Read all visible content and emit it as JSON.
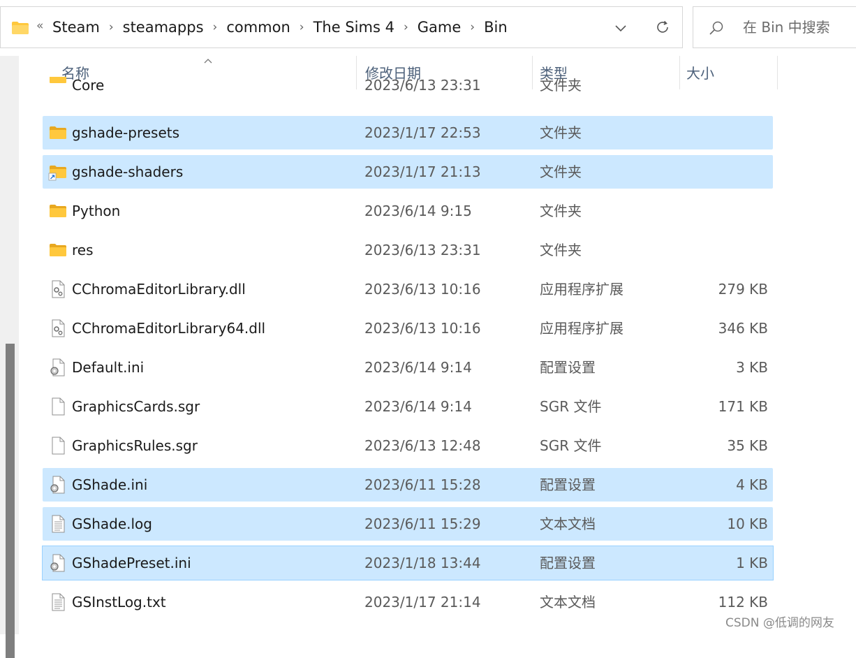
{
  "address_bar": {
    "overflow": "«",
    "crumbs": [
      "Steam",
      "steamapps",
      "common",
      "The Sims 4",
      "Game",
      "Bin"
    ]
  },
  "search": {
    "placeholder": "在 Bin 中搜索"
  },
  "columns": {
    "name": "名称",
    "date": "修改日期",
    "type": "类型",
    "size": "大小"
  },
  "files": [
    {
      "name": "Core",
      "date": "2023/6/13 23:31",
      "type": "文件夹",
      "size": "",
      "icon": "folder-icon",
      "state": "partial"
    },
    {
      "name": "gshade-presets",
      "date": "2023/1/17 22:53",
      "type": "文件夹",
      "size": "",
      "icon": "folder-icon",
      "state": "selected"
    },
    {
      "name": "gshade-shaders",
      "date": "2023/1/17 21:13",
      "type": "文件夹",
      "size": "",
      "icon": "folder-shortcut-icon",
      "state": "selected"
    },
    {
      "name": "Python",
      "date": "2023/6/14 9:15",
      "type": "文件夹",
      "size": "",
      "icon": "folder-icon",
      "state": ""
    },
    {
      "name": "res",
      "date": "2023/6/13 23:31",
      "type": "文件夹",
      "size": "",
      "icon": "folder-icon",
      "state": ""
    },
    {
      "name": "CChromaEditorLibrary.dll",
      "date": "2023/6/13 10:16",
      "type": "应用程序扩展",
      "size": "279 KB",
      "icon": "dll-file-icon",
      "state": ""
    },
    {
      "name": "CChromaEditorLibrary64.dll",
      "date": "2023/6/13 10:16",
      "type": "应用程序扩展",
      "size": "346 KB",
      "icon": "dll-file-icon",
      "state": ""
    },
    {
      "name": "Default.ini",
      "date": "2023/6/14 9:14",
      "type": "配置设置",
      "size": "3 KB",
      "icon": "settings-file-icon",
      "state": ""
    },
    {
      "name": "GraphicsCards.sgr",
      "date": "2023/6/14 9:14",
      "type": "SGR 文件",
      "size": "171 KB",
      "icon": "blank-file-icon",
      "state": ""
    },
    {
      "name": "GraphicsRules.sgr",
      "date": "2023/6/13 12:48",
      "type": "SGR 文件",
      "size": "35 KB",
      "icon": "blank-file-icon",
      "state": ""
    },
    {
      "name": "GShade.ini",
      "date": "2023/6/11 15:28",
      "type": "配置设置",
      "size": "4 KB",
      "icon": "settings-file-icon",
      "state": "selected"
    },
    {
      "name": "GShade.log",
      "date": "2023/6/11 15:29",
      "type": "文本文档",
      "size": "10 KB",
      "icon": "text-file-icon",
      "state": "selected"
    },
    {
      "name": "GShadePreset.ini",
      "date": "2023/1/18 13:44",
      "type": "配置设置",
      "size": "1 KB",
      "icon": "settings-file-icon",
      "state": "focused"
    },
    {
      "name": "GSInstLog.txt",
      "date": "2023/1/17 21:14",
      "type": "文本文档",
      "size": "112 KB",
      "icon": "text-file-icon",
      "state": ""
    }
  ],
  "watermark": "CSDN @低调的网友",
  "colors": {
    "selection": "#cce8ff",
    "selection_border": "#99d1ff",
    "folder": "#ffc83d",
    "header_text": "#4c607a"
  }
}
